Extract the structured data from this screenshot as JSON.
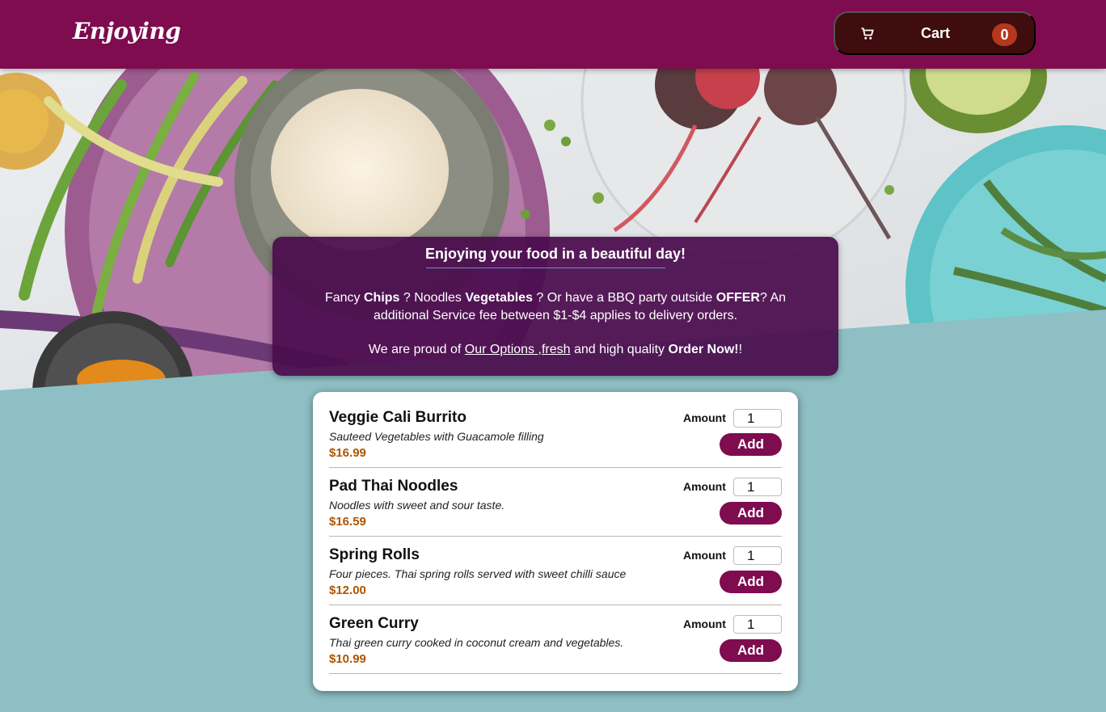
{
  "header": {
    "logo": "Enjoying",
    "cart_label": "Cart",
    "cart_count": "0",
    "cart_icon": "shopping-cart-icon"
  },
  "summary": {
    "title": "Enjoying your food in a beautiful day!",
    "line1": {
      "t1": "Fancy ",
      "b1": "Chips",
      "t2": " ? Noodles ",
      "b2": "Vegetables",
      "t3": " ? Or have a BBQ party outside ",
      "b3": "OFFER",
      "t4": "? An additional Service fee between $1-$4 applies to delivery orders."
    },
    "line2": {
      "t1": "We are proud of ",
      "link": "Our Options ,fresh",
      "t2": " and high quality ",
      "b1": "Order Now!",
      "t3": "!"
    }
  },
  "menu": {
    "amount_label": "Amount",
    "add_label": "Add",
    "meals": [
      {
        "name": "Veggie Cali Burrito",
        "description": "Sauteed Vegetables with Guacamole filling",
        "price": "$16.99",
        "amount": "1"
      },
      {
        "name": "Pad Thai Noodles",
        "description": "Noodles with sweet and sour taste.",
        "price": "$16.59",
        "amount": "1"
      },
      {
        "name": "Spring Rolls",
        "description": "Four pieces. Thai spring rolls served with sweet chilli sauce",
        "price": "$12.00",
        "amount": "1"
      },
      {
        "name": "Green Curry",
        "description": "Thai green curry cooked in coconut cream and vegetables.",
        "price": "$10.99",
        "amount": "1"
      }
    ]
  },
  "colors": {
    "header": "#7e0c4f",
    "cart_button": "#3f0d0d",
    "badge": "#b5371c",
    "summary": "#4a0c4e",
    "price": "#ad5502",
    "background": "#8ebfc4"
  }
}
